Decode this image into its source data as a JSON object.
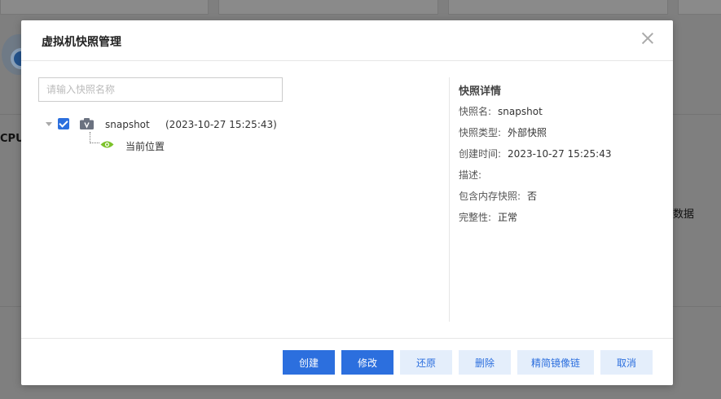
{
  "dialog": {
    "title": "虚拟机快照管理",
    "search_placeholder": "请输入快照名称"
  },
  "tree": {
    "snapshot": {
      "name": "snapshot",
      "time": "(2023-10-27 15:25:43)",
      "checked": true
    },
    "current_position": "当前位置"
  },
  "details": {
    "title": "快照详情",
    "rows": [
      {
        "label": "快照名:",
        "value": "snapshot"
      },
      {
        "label": "快照类型:",
        "value": "外部快照"
      },
      {
        "label": "创建时间:",
        "value": "2023-10-27 15:25:43"
      },
      {
        "label": "描述:",
        "value": ""
      },
      {
        "label": "包含内存快照:",
        "value": "否"
      },
      {
        "label": "完整性:",
        "value": "正常"
      }
    ]
  },
  "buttons": {
    "create": "创建",
    "modify": "修改",
    "restore": "还原",
    "delete": "删除",
    "simplify_chain": "精简镜像链",
    "cancel": "取消"
  },
  "background": {
    "cpu_label": "CPU",
    "data_label": "数据"
  },
  "colors": {
    "primary": "#2c6fde",
    "light_button": "#e4eefb",
    "eye_green": "#7cc22a"
  }
}
